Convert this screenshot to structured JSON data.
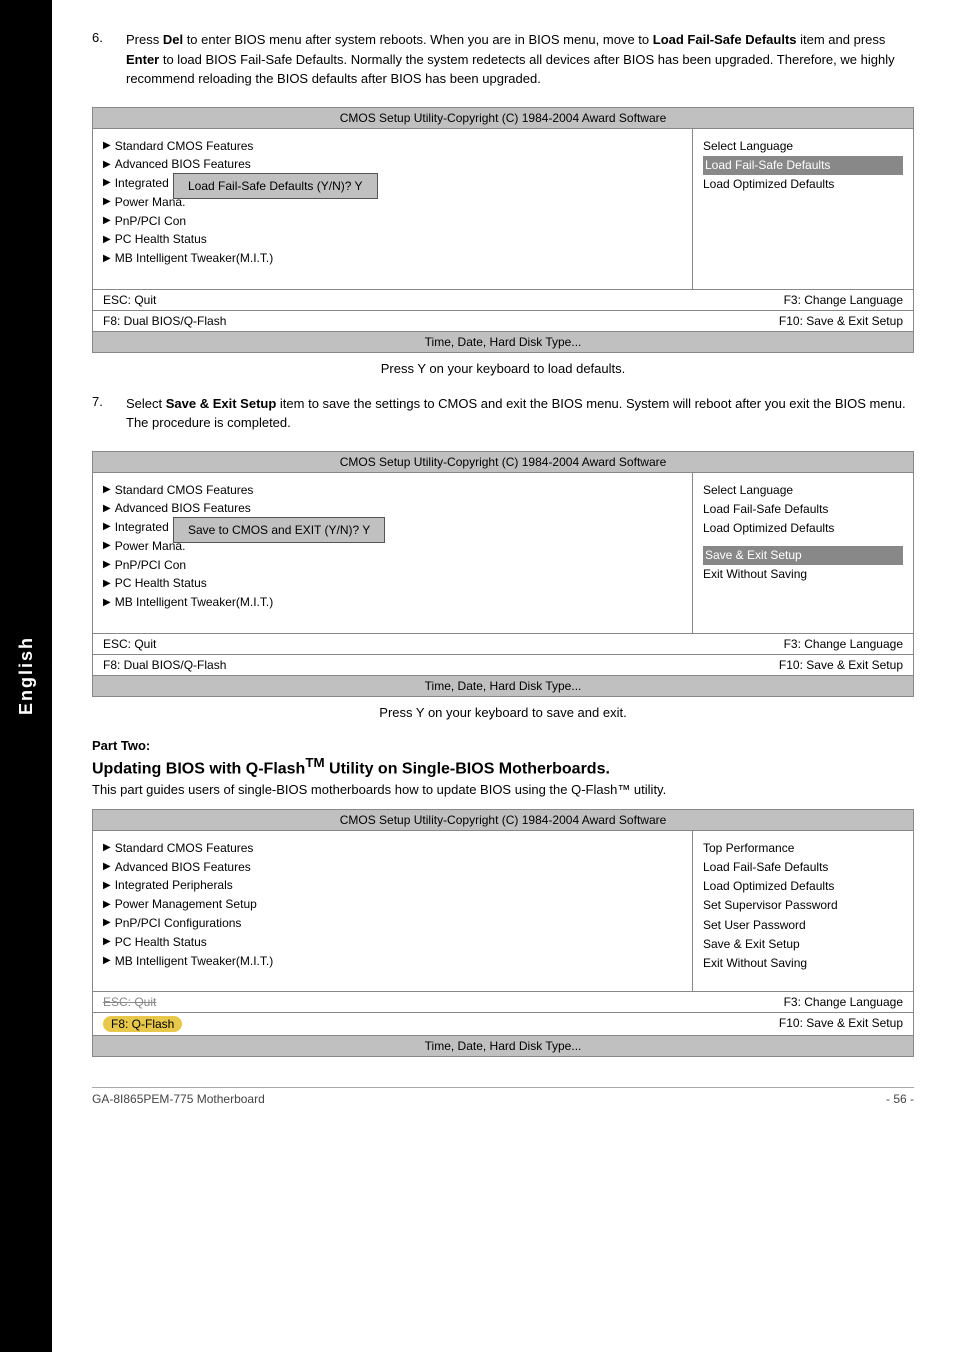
{
  "sidebar": {
    "label": "English"
  },
  "step6": {
    "number": "6.",
    "text_parts": [
      "Press ",
      "Del",
      " to enter BIOS menu after system reboots. When you are in BIOS menu, move to ",
      "Load Fail-Safe Defaults",
      " item and press ",
      "Enter",
      " to load BIOS Fail-Safe Defaults. Normally the system redetects all devices after BIOS has been upgraded. Therefore, we highly recommend reloading the BIOS defaults after BIOS has been upgraded."
    ],
    "caption": "Press Y on your keyboard to load defaults."
  },
  "step7": {
    "number": "7.",
    "text_parts": [
      "Select ",
      "Save & Exit Setup",
      " item to save the settings to CMOS and exit the BIOS menu. System will reboot after you exit the BIOS menu. The procedure is completed."
    ],
    "caption": "Press Y on your keyboard to save and exit."
  },
  "bios1": {
    "title": "CMOS Setup Utility-Copyright (C) 1984-2004 Award Software",
    "left_items": [
      "Standard CMOS Features",
      "Advanced BIOS Features",
      "Integrated Peripherals",
      "Power Mana.",
      "PnP/PCI Con",
      "PC Health Status",
      "MB Intelligent Tweaker(M.I.T.)"
    ],
    "right_items": [
      {
        "text": "Select Language",
        "highlighted": false
      },
      {
        "text": "Load Fail-Safe Defaults",
        "highlighted": true
      },
      {
        "text": "Load Optimized Defaults",
        "highlighted": false
      }
    ],
    "dialog_text": "Load Fail-Safe Defaults (Y/N)? Y",
    "footer_left1": "ESC: Quit",
    "footer_left2": "F8: Dual BIOS/Q-Flash",
    "footer_right1": "F3: Change Language",
    "footer_right2": "F10: Save & Exit Setup",
    "bottom": "Time, Date, Hard Disk Type..."
  },
  "bios2": {
    "title": "CMOS Setup Utility-Copyright (C) 1984-2004 Award Software",
    "left_items": [
      "Standard CMOS Features",
      "Advanced BIOS Features",
      "Integrated Peripherals",
      "Power Mana.",
      "PnP/PCI Con",
      "PC Health Status",
      "MB Intelligent Tweaker(M.I.T.)"
    ],
    "right_items": [
      {
        "text": "Select Language",
        "highlighted": false
      },
      {
        "text": "Load Fail-Safe Defaults",
        "highlighted": false
      },
      {
        "text": "Load Optimized Defaults",
        "highlighted": false
      }
    ],
    "dialog_text": "Save to CMOS and EXIT (Y/N)? Y",
    "footer_left1": "ESC: Quit",
    "footer_left2": "F8: Dual BIOS/Q-Flash",
    "footer_right1": "F3: Change Language",
    "footer_right2": "F10: Save & Exit Setup",
    "save_exit_highlighted": true,
    "right_items2": [
      {
        "text": "Save & Exit Setup",
        "highlighted": true
      },
      {
        "text": "Exit Without Saving",
        "highlighted": false
      }
    ],
    "bottom": "Time, Date, Hard Disk Type..."
  },
  "bios3": {
    "title": "CMOS Setup Utility-Copyright (C) 1984-2004 Award Software",
    "left_items": [
      "Standard CMOS Features",
      "Advanced BIOS Features",
      "Integrated Peripherals",
      "Power Management Setup",
      "PnP/PCI Configurations",
      "PC Health Status",
      "MB Intelligent Tweaker(M.I.T.)"
    ],
    "right_items": [
      {
        "text": "Top Performance",
        "highlighted": false
      },
      {
        "text": "Load Fail-Safe Defaults",
        "highlighted": false
      },
      {
        "text": "Load Optimized Defaults",
        "highlighted": false
      },
      {
        "text": "Set Supervisor Password",
        "highlighted": false
      },
      {
        "text": "Set User Password",
        "highlighted": false
      },
      {
        "text": "Save & Exit Setup",
        "highlighted": false
      },
      {
        "text": "Exit Without Saving",
        "highlighted": false
      }
    ],
    "footer_left1": "ESC: Quit",
    "footer_left2": "F8: Q-Flash",
    "footer_right1": "F3: Change Language",
    "footer_right2": "F10: Save & Exit Setup",
    "bottom": "Time, Date, Hard Disk Type..."
  },
  "part_two": {
    "label": "Part Two:",
    "title": "Updating BIOS with Q-Flash™ Utility on Single-BIOS Motherboards.",
    "description": "This part guides users of single-BIOS motherboards how to update BIOS using the Q-Flash™ utility."
  },
  "footer": {
    "left": "GA-8I865PEM-775 Motherboard",
    "right": "- 56 -"
  }
}
